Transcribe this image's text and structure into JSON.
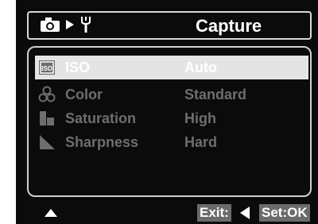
{
  "header": {
    "title": "Capture",
    "icons": [
      "camera-icon",
      "play-arrow-icon",
      "wrench-icon"
    ]
  },
  "menu": {
    "items": [
      {
        "label": "ISO",
        "value": "Auto",
        "icon": "iso-icon",
        "selected": true
      },
      {
        "label": "Color",
        "value": "Standard",
        "icon": "color-icon",
        "selected": false
      },
      {
        "label": "Saturation",
        "value": "High",
        "icon": "saturation-icon",
        "selected": false
      },
      {
        "label": "Sharpness",
        "value": "Hard",
        "icon": "sharpness-icon",
        "selected": false
      }
    ]
  },
  "footer": {
    "exit_label": "Exit:",
    "set_label": "Set:OK"
  },
  "colors": {
    "background": "#0b0b0b",
    "selected_row": "#e4e4e4",
    "inactive_text": "#6e6e6e",
    "footer_key": "#6b6b6b"
  }
}
